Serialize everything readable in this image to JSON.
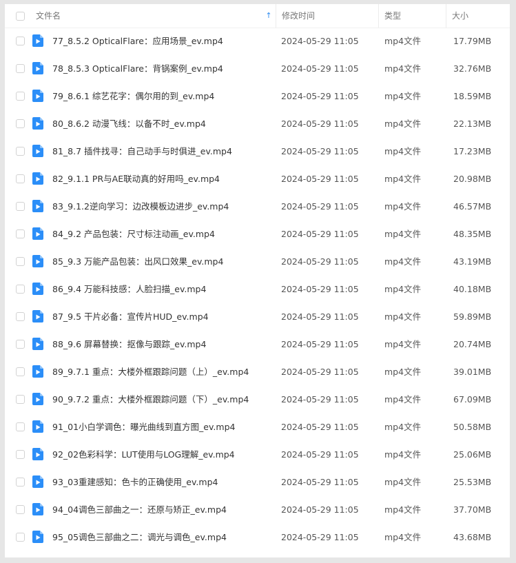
{
  "header": {
    "name_label": "文件名",
    "time_label": "修改时间",
    "type_label": "类型",
    "size_label": "大小",
    "sort_indicator": "↑"
  },
  "colors": {
    "accent": "#2f8cf0",
    "video_icon": "#2b8ef8"
  },
  "rows": [
    {
      "name": "77_8.5.2 OpticalFlare：应用场景_ev.mp4",
      "time": "2024-05-29 11:05",
      "type": "mp4文件",
      "size": "17.79MB"
    },
    {
      "name": "78_8.5.3 OpticalFlare：背锅案例_ev.mp4",
      "time": "2024-05-29 11:05",
      "type": "mp4文件",
      "size": "32.76MB"
    },
    {
      "name": "79_8.6.1 综艺花字：偶尔用的到_ev.mp4",
      "time": "2024-05-29 11:05",
      "type": "mp4文件",
      "size": "18.59MB"
    },
    {
      "name": "80_8.6.2 动漫飞线：以备不时_ev.mp4",
      "time": "2024-05-29 11:05",
      "type": "mp4文件",
      "size": "22.13MB"
    },
    {
      "name": "81_8.7 插件找寻：自己动手与时俱进_ev.mp4",
      "time": "2024-05-29 11:05",
      "type": "mp4文件",
      "size": "17.23MB"
    },
    {
      "name": "82_9.1.1 PR与AE联动真的好用吗_ev.mp4",
      "time": "2024-05-29 11:05",
      "type": "mp4文件",
      "size": "20.98MB"
    },
    {
      "name": "83_9.1.2逆向学习：边改模板边进步_ev.mp4",
      "time": "2024-05-29 11:05",
      "type": "mp4文件",
      "size": "46.57MB"
    },
    {
      "name": "84_9.2 产品包装：尺寸标注动画_ev.mp4",
      "time": "2024-05-29 11:05",
      "type": "mp4文件",
      "size": "48.35MB"
    },
    {
      "name": "85_9.3 万能产品包装：出风口效果_ev.mp4",
      "time": "2024-05-29 11:05",
      "type": "mp4文件",
      "size": "43.19MB"
    },
    {
      "name": "86_9.4 万能科技感：人脸扫描_ev.mp4",
      "time": "2024-05-29 11:05",
      "type": "mp4文件",
      "size": "40.18MB"
    },
    {
      "name": "87_9.5 干片必备：宣传片HUD_ev.mp4",
      "time": "2024-05-29 11:05",
      "type": "mp4文件",
      "size": "59.89MB"
    },
    {
      "name": "88_9.6 屏幕替换：抠像与跟踪_ev.mp4",
      "time": "2024-05-29 11:05",
      "type": "mp4文件",
      "size": "20.74MB"
    },
    {
      "name": "89_9.7.1 重点：大楼外框跟踪问题（上）_ev.mp4",
      "time": "2024-05-29 11:05",
      "type": "mp4文件",
      "size": "39.01MB"
    },
    {
      "name": "90_9.7.2 重点：大楼外框跟踪问题（下）_ev.mp4",
      "time": "2024-05-29 11:05",
      "type": "mp4文件",
      "size": "67.09MB"
    },
    {
      "name": "91_01小白学调色：曝光曲线到直方图_ev.mp4",
      "time": "2024-05-29 11:05",
      "type": "mp4文件",
      "size": "50.58MB"
    },
    {
      "name": "92_02色彩科学：LUT使用与LOG理解_ev.mp4",
      "time": "2024-05-29 11:05",
      "type": "mp4文件",
      "size": "25.06MB"
    },
    {
      "name": "93_03重建感知：色卡的正确使用_ev.mp4",
      "time": "2024-05-29 11:05",
      "type": "mp4文件",
      "size": "25.53MB"
    },
    {
      "name": "94_04调色三部曲之一：还原与矫正_ev.mp4",
      "time": "2024-05-29 11:05",
      "type": "mp4文件",
      "size": "37.70MB"
    },
    {
      "name": "95_05调色三部曲之二：调光与调色_ev.mp4",
      "time": "2024-05-29 11:05",
      "type": "mp4文件",
      "size": "43.68MB"
    }
  ]
}
